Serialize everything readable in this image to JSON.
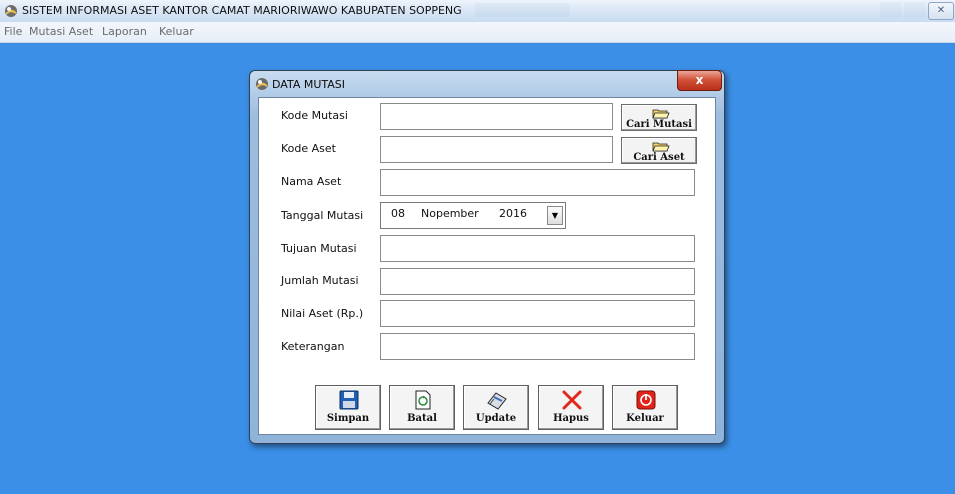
{
  "window": {
    "title": "SISTEM INFORMASI ASET KANTOR CAMAT MARIORIWAWO KABUPATEN SOPPENG",
    "close_symbol": "✕"
  },
  "menubar": {
    "items": [
      {
        "label": "File"
      },
      {
        "label": "Mutasi Aset"
      },
      {
        "label": "Laporan"
      },
      {
        "label": "Keluar"
      }
    ]
  },
  "dialog": {
    "title": "DATA MUTASI",
    "close_symbol": "x",
    "fields": {
      "kode_mutasi": {
        "label": "Kode Mutasi",
        "value": ""
      },
      "kode_aset": {
        "label": "Kode Aset",
        "value": ""
      },
      "nama_aset": {
        "label": "Nama Aset",
        "value": ""
      },
      "tanggal_mutasi": {
        "label": "Tanggal Mutasi",
        "day": "08",
        "month": "Nopember",
        "year": "2016"
      },
      "tujuan_mutasi": {
        "label": "Tujuan Mutasi",
        "value": ""
      },
      "jumlah_mutasi": {
        "label": "Jumlah Mutasi",
        "value": ""
      },
      "nilai_aset": {
        "label": "Nilai Aset (Rp.)",
        "value": ""
      },
      "keterangan": {
        "label": "Keterangan",
        "value": ""
      }
    },
    "lookup_buttons": {
      "cari_mutasi": {
        "label": "Cari Mutasi",
        "icon": "folder-open-icon"
      },
      "cari_aset": {
        "label": "Cari Aset",
        "icon": "folder-open-icon"
      }
    },
    "actions": [
      {
        "key": "simpan",
        "label": "Simpan",
        "icon": "floppy-disk-icon"
      },
      {
        "key": "batal",
        "label": "Batal",
        "icon": "refresh-document-icon"
      },
      {
        "key": "update",
        "label": "Update",
        "icon": "edit-pen-icon"
      },
      {
        "key": "hapus",
        "label": "Hapus",
        "icon": "red-x-icon"
      },
      {
        "key": "keluar",
        "label": "Keluar",
        "icon": "power-icon"
      }
    ]
  },
  "colors": {
    "desktop": "#3b8fe6",
    "dialog_frame": "#9dbddf",
    "close_red": "#c8402a"
  }
}
